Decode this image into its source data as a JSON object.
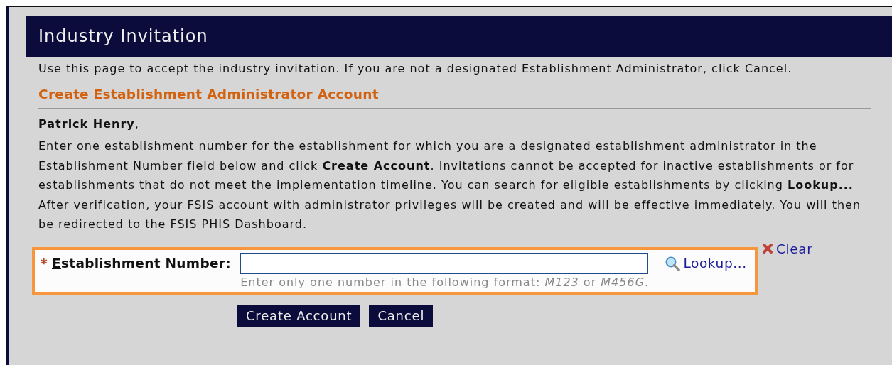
{
  "header": {
    "title": "Industry Invitation"
  },
  "intro": "Use this page to accept the industry invitation. If you are not a designated Establishment Administrator, click Cancel.",
  "section_title": "Create Establishment Administrator Account",
  "greeting": "**Patrick Henry**,",
  "paragraphs": [
    "Enter one establishment number for the establishment for which you are a designated establishment administrator in the Establishment Number field below and click **Create Account**. Invitations cannot be accepted for inactive establishments or for establishments that do not meet the implementation timeline. You can search for eligible establishments by clicking **Lookup...**",
    "After verification, your FSIS account with administrator privileges will be created and will be effective immediately. You will then be redirected to the FSIS PHIS Dashboard."
  ],
  "field": {
    "required_mark": "*",
    "label": "Establishment Number:",
    "hint": "Enter only one number in the following format: *M123* or *M456G*.",
    "highlighted": true
  },
  "links": [
    "Lookup...",
    "Clear"
  ],
  "buttons": [
    "Create Account",
    "Cancel"
  ]
}
